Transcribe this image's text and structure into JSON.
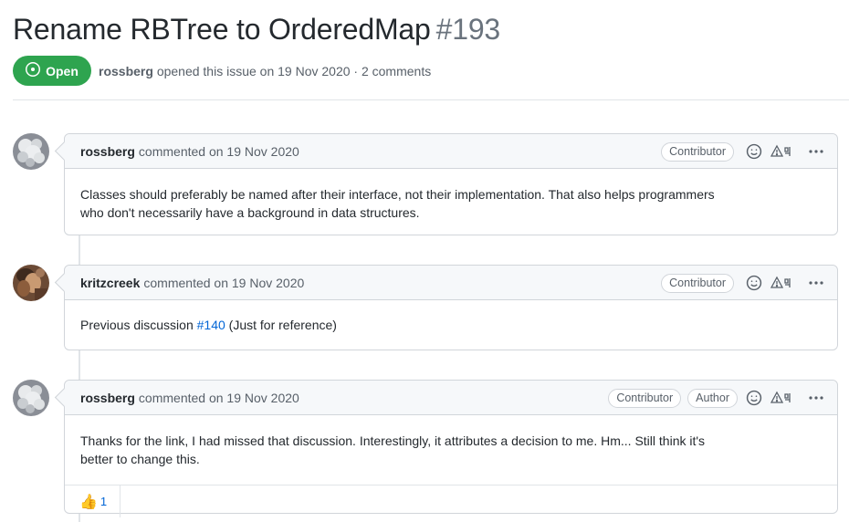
{
  "issue": {
    "title": "Rename RBTree to OrderedMap",
    "number": "#193",
    "state_label": "Open",
    "author": "rossberg",
    "meta_text": "opened this issue on 19 Nov 2020 · 2 comments"
  },
  "comments": [
    {
      "author": "rossberg",
      "action": "commented on 19 Nov 2020",
      "badges": [
        "Contributor"
      ],
      "body_lines": [
        "Classes should preferably be named after their interface, not their implementation. That also helps programmers",
        "who don't necessarily have a background in data structures."
      ]
    },
    {
      "author": "kritzcreek",
      "action": "commented on 19 Nov 2020",
      "badges": [
        "Contributor"
      ],
      "body_prefix": "Previous discussion",
      "body_link": "#140",
      "body_suffix": "(Just for reference)"
    },
    {
      "author": "rossberg",
      "action": "commented on 19 Nov 2020",
      "badges": [
        "Contributor",
        "Author"
      ],
      "body_lines": [
        "Thanks for the link, I had missed that discussion. Interestingly, it attributes a decision to me. Hm... Still think it's",
        "better to change this."
      ],
      "reactions": [
        {
          "emoji": "👍",
          "count": "1"
        }
      ]
    }
  ],
  "icons": {
    "state": "issue-opened-icon",
    "emoji": "smiley-icon",
    "report": "report-icon",
    "more": "kebab-horizontal-icon"
  },
  "colors": {
    "open_green": "#2ea44f",
    "link_blue": "#0366d6",
    "muted": "#586069",
    "border": "#d1d5da"
  }
}
